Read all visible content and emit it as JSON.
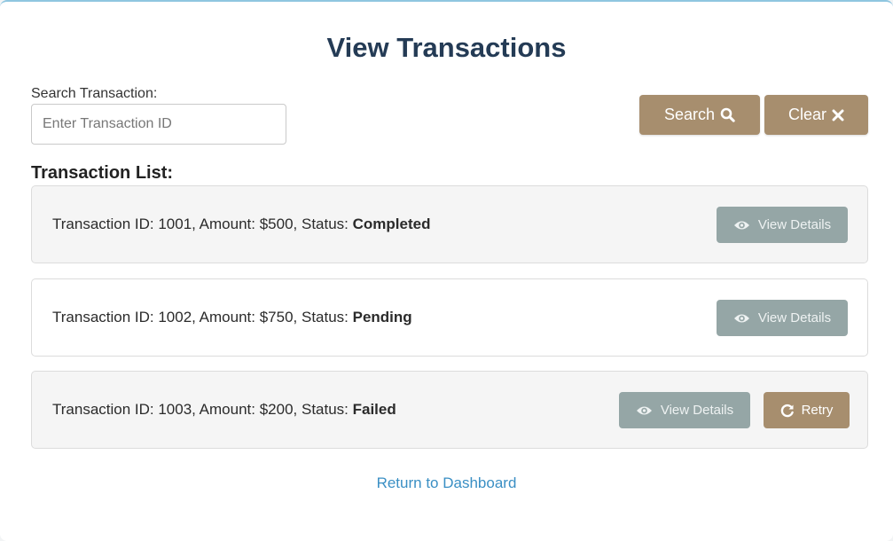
{
  "page": {
    "title": "View Transactions"
  },
  "search": {
    "label": "Search Transaction:",
    "placeholder": "Enter Transaction ID",
    "value": "",
    "search_button": "Search",
    "clear_button": "Clear"
  },
  "list": {
    "heading": "Transaction List:",
    "transactions": [
      {
        "prefix": "Transaction ID: 1001, Amount: $500, Status: ",
        "status": "Completed",
        "view_label": "View Details"
      },
      {
        "prefix": "Transaction ID: 1002, Amount: $750, Status: ",
        "status": "Pending",
        "view_label": "View Details"
      },
      {
        "prefix": "Transaction ID: 1003, Amount: $200, Status: ",
        "status": "Failed",
        "view_label": "View Details",
        "retry_label": "Retry"
      }
    ]
  },
  "footer": {
    "dashboard_link": "Return to Dashboard"
  },
  "colors": {
    "title": "#243b55",
    "accent_brown": "#a78e6e",
    "view_button_gray": "#95a6a6",
    "link_blue": "#3a8fc4",
    "top_border": "#8fc6e0"
  },
  "icons": {
    "search": "search-icon",
    "clear": "close-icon",
    "view": "eye-icon",
    "retry": "retry-icon"
  }
}
